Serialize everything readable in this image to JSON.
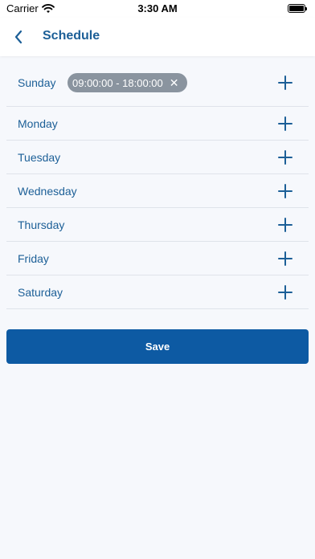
{
  "status_bar": {
    "carrier": "Carrier",
    "time": "3:30 AM"
  },
  "header": {
    "title": "Schedule"
  },
  "days": [
    {
      "label": "Sunday",
      "slots": [
        "09:00:00 - 18:00:00"
      ]
    },
    {
      "label": "Monday",
      "slots": []
    },
    {
      "label": "Tuesday",
      "slots": []
    },
    {
      "label": "Wednesday",
      "slots": []
    },
    {
      "label": "Thursday",
      "slots": []
    },
    {
      "label": "Friday",
      "slots": []
    },
    {
      "label": "Saturday",
      "slots": []
    }
  ],
  "chip_remove_glyph": "✕",
  "save_label": "Save",
  "colors": {
    "accent": "#1c5f97",
    "primary_button": "#0d5aa3",
    "chip": "#8a949f"
  }
}
